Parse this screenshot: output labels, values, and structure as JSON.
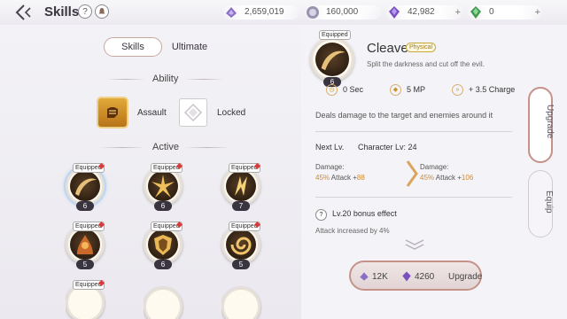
{
  "header": {
    "title": "Skills",
    "help_label": "?",
    "currencies": [
      {
        "icon": "crystal-bundle-icon",
        "value": "2,659,019"
      },
      {
        "icon": "silver-coin-icon",
        "value": "160,000"
      },
      {
        "icon": "purple-gem-icon",
        "value": "42,982"
      },
      {
        "icon": "green-gem-icon",
        "value": "0"
      }
    ]
  },
  "tabs": {
    "skills": "Skills",
    "ultimate": "Ultimate"
  },
  "ability": {
    "heading": "Ability",
    "items": [
      {
        "label": "Assault",
        "icon": "fist-icon"
      },
      {
        "label": "Locked",
        "icon": "locked-slot-icon"
      }
    ]
  },
  "active": {
    "heading": "Active",
    "skills": [
      {
        "badge": "Equipped",
        "level": "6",
        "icon": "slash-arc-icon"
      },
      {
        "badge": "Equipped",
        "level": "6",
        "icon": "burst-spikes-icon"
      },
      {
        "badge": "Equipped",
        "level": "7",
        "icon": "lightning-blades-icon"
      },
      {
        "badge": "Equipped",
        "level": "5",
        "icon": "fire-creature-icon"
      },
      {
        "badge": "Equipped",
        "level": "6",
        "icon": "shield-burst-icon"
      },
      {
        "badge": "Equipped",
        "level": "5",
        "icon": "golden-spiral-icon"
      },
      {
        "badge": "Equipped",
        "level": "",
        "icon": "partial-skill-icon"
      }
    ]
  },
  "detail": {
    "badge": "Equipped",
    "level": "6",
    "name": "Cleave",
    "tag": "Physical",
    "subtitle": "Split the darkness and cut off the evil.",
    "cooldown": "0 Sec",
    "cost": "5 MP",
    "charge": "+ 3.5 Charge",
    "description": "Deals damage to the target and enemies around it",
    "next_label": "Next Lv.",
    "char_level": "Character Lv: 24",
    "damage_label": "Damage:",
    "damage_current_pct": "45%",
    "damage_current_attack": " Attack +",
    "damage_current_value": "88",
    "damage_next_pct": "45%",
    "damage_next_attack": " Attack +",
    "damage_next_value": "106",
    "bonus_title": "Lv.20 bonus effect",
    "bonus_desc": "Attack increased by 4%"
  },
  "upgrade": {
    "cost1": "12K",
    "cost2": "4260",
    "label": "Upgrade"
  },
  "side_tabs": {
    "upgrade": "Upgrade",
    "equip": "Equip"
  },
  "colors": {
    "accent": "#c5928a",
    "orange": "#d28b2b",
    "gold": "#c9a83c"
  }
}
